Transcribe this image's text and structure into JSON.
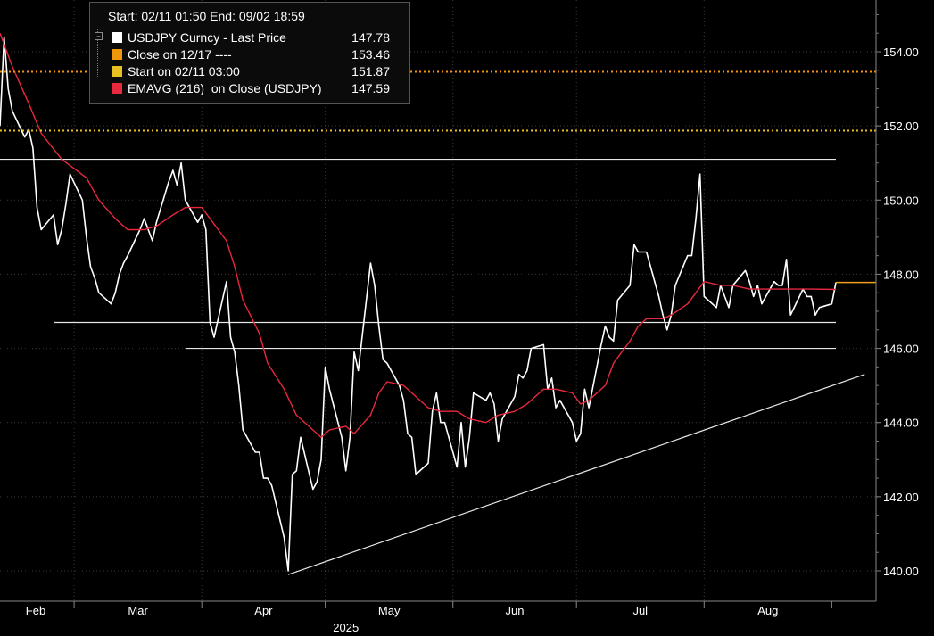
{
  "legend": {
    "header": "Start: 02/11 01:50 End: 09/02 18:59",
    "items": [
      {
        "label": "USDJPY Curncy - Last Price",
        "value": "147.78",
        "color": "#ffffff"
      },
      {
        "label": "Close on 12/17 ----",
        "value": "153.46",
        "color": "#f0960a"
      },
      {
        "label": "Start on 02/11 03:00",
        "value": "151.87",
        "color": "#e8c020"
      },
      {
        "label": "EMAVG (216)  on Close (USDJPY)",
        "value": "147.59",
        "color": "#e8283c"
      }
    ]
  },
  "chart_data": {
    "type": "line",
    "x_axis": {
      "months": [
        "Feb",
        "Mar",
        "Apr",
        "May",
        "Jun",
        "Jul",
        "Aug"
      ],
      "year": "2025",
      "range": [
        "2025-02-11",
        "2025-09-02"
      ]
    },
    "y_axis": {
      "ticks": [
        "154.00",
        "152.00",
        "150.00",
        "148.00",
        "146.00",
        "144.00",
        "142.00",
        "140.00"
      ],
      "range": [
        139.6,
        155.6
      ],
      "position": "right"
    },
    "series": [
      {
        "name": "USDJPY Curncy - Last Price",
        "color": "#ffffff",
        "points": [
          [
            "2025-02-11",
            152.0
          ],
          [
            "2025-02-12",
            154.4
          ],
          [
            "2025-02-13",
            153.0
          ],
          [
            "2025-02-14",
            152.4
          ],
          [
            "2025-02-17",
            151.7
          ],
          [
            "2025-02-18",
            151.9
          ],
          [
            "2025-02-19",
            151.4
          ],
          [
            "2025-02-20",
            149.8
          ],
          [
            "2025-02-21",
            149.2
          ],
          [
            "2025-02-24",
            149.6
          ],
          [
            "2025-02-25",
            148.8
          ],
          [
            "2025-02-26",
            149.2
          ],
          [
            "2025-02-27",
            149.9
          ],
          [
            "2025-02-28",
            150.7
          ],
          [
            "2025-03-03",
            150.0
          ],
          [
            "2025-03-04",
            149.0
          ],
          [
            "2025-03-05",
            148.2
          ],
          [
            "2025-03-06",
            147.9
          ],
          [
            "2025-03-07",
            147.5
          ],
          [
            "2025-03-10",
            147.2
          ],
          [
            "2025-03-11",
            147.5
          ],
          [
            "2025-03-12",
            148.0
          ],
          [
            "2025-03-13",
            148.3
          ],
          [
            "2025-03-14",
            148.5
          ],
          [
            "2025-03-17",
            149.2
          ],
          [
            "2025-03-18",
            149.5
          ],
          [
            "2025-03-19",
            149.2
          ],
          [
            "2025-03-20",
            148.9
          ],
          [
            "2025-03-21",
            149.4
          ],
          [
            "2025-03-24",
            150.5
          ],
          [
            "2025-03-25",
            150.8
          ],
          [
            "2025-03-26",
            150.4
          ],
          [
            "2025-03-27",
            151.0
          ],
          [
            "2025-03-28",
            150.0
          ],
          [
            "2025-03-31",
            149.4
          ],
          [
            "2025-04-01",
            149.6
          ],
          [
            "2025-04-02",
            149.2
          ],
          [
            "2025-04-03",
            146.7
          ],
          [
            "2025-04-04",
            146.3
          ],
          [
            "2025-04-07",
            147.8
          ],
          [
            "2025-04-08",
            146.3
          ],
          [
            "2025-04-09",
            145.9
          ],
          [
            "2025-04-10",
            145.0
          ],
          [
            "2025-04-11",
            143.8
          ],
          [
            "2025-04-14",
            143.2
          ],
          [
            "2025-04-15",
            143.2
          ],
          [
            "2025-04-16",
            142.5
          ],
          [
            "2025-04-17",
            142.5
          ],
          [
            "2025-04-18",
            142.3
          ],
          [
            "2025-04-21",
            140.9
          ],
          [
            "2025-04-22",
            140.0
          ],
          [
            "2025-04-23",
            142.6
          ],
          [
            "2025-04-24",
            142.7
          ],
          [
            "2025-04-25",
            143.6
          ],
          [
            "2025-04-28",
            142.2
          ],
          [
            "2025-04-29",
            142.4
          ],
          [
            "2025-04-30",
            143.0
          ],
          [
            "2025-05-01",
            145.5
          ],
          [
            "2025-05-02",
            144.9
          ],
          [
            "2025-05-05",
            143.6
          ],
          [
            "2025-05-06",
            142.7
          ],
          [
            "2025-05-07",
            143.6
          ],
          [
            "2025-05-08",
            145.9
          ],
          [
            "2025-05-09",
            145.4
          ],
          [
            "2025-05-12",
            148.3
          ],
          [
            "2025-05-13",
            147.7
          ],
          [
            "2025-05-14",
            146.6
          ],
          [
            "2025-05-15",
            145.7
          ],
          [
            "2025-05-16",
            145.6
          ],
          [
            "2025-05-19",
            145.0
          ],
          [
            "2025-05-20",
            144.6
          ],
          [
            "2025-05-21",
            143.7
          ],
          [
            "2025-05-22",
            143.6
          ],
          [
            "2025-05-23",
            142.6
          ],
          [
            "2025-05-26",
            142.9
          ],
          [
            "2025-05-27",
            144.3
          ],
          [
            "2025-05-28",
            144.8
          ],
          [
            "2025-05-29",
            144.0
          ],
          [
            "2025-05-30",
            144.0
          ],
          [
            "2025-06-02",
            142.8
          ],
          [
            "2025-06-03",
            144.0
          ],
          [
            "2025-06-04",
            142.8
          ],
          [
            "2025-06-05",
            143.6
          ],
          [
            "2025-06-06",
            144.8
          ],
          [
            "2025-06-09",
            144.6
          ],
          [
            "2025-06-10",
            144.8
          ],
          [
            "2025-06-11",
            144.5
          ],
          [
            "2025-06-12",
            143.5
          ],
          [
            "2025-06-13",
            144.1
          ],
          [
            "2025-06-16",
            144.7
          ],
          [
            "2025-06-17",
            145.3
          ],
          [
            "2025-06-18",
            145.2
          ],
          [
            "2025-06-19",
            145.4
          ],
          [
            "2025-06-20",
            146.0
          ],
          [
            "2025-06-23",
            146.1
          ],
          [
            "2025-06-24",
            144.9
          ],
          [
            "2025-06-25",
            145.2
          ],
          [
            "2025-06-26",
            144.4
          ],
          [
            "2025-06-27",
            144.6
          ],
          [
            "2025-06-30",
            144.0
          ],
          [
            "2025-07-01",
            143.5
          ],
          [
            "2025-07-02",
            143.7
          ],
          [
            "2025-07-03",
            144.9
          ],
          [
            "2025-07-04",
            144.4
          ],
          [
            "2025-07-07",
            146.1
          ],
          [
            "2025-07-08",
            146.6
          ],
          [
            "2025-07-09",
            146.3
          ],
          [
            "2025-07-10",
            146.2
          ],
          [
            "2025-07-11",
            147.3
          ],
          [
            "2025-07-14",
            147.7
          ],
          [
            "2025-07-15",
            148.8
          ],
          [
            "2025-07-16",
            148.6
          ],
          [
            "2025-07-17",
            148.6
          ],
          [
            "2025-07-18",
            148.6
          ],
          [
            "2025-07-21",
            147.4
          ],
          [
            "2025-07-22",
            146.9
          ],
          [
            "2025-07-23",
            146.5
          ],
          [
            "2025-07-24",
            146.9
          ],
          [
            "2025-07-25",
            147.7
          ],
          [
            "2025-07-28",
            148.5
          ],
          [
            "2025-07-29",
            148.5
          ],
          [
            "2025-07-30",
            149.5
          ],
          [
            "2025-07-31",
            150.7
          ],
          [
            "2025-08-01",
            147.4
          ],
          [
            "2025-08-04",
            147.1
          ],
          [
            "2025-08-05",
            147.7
          ],
          [
            "2025-08-06",
            147.4
          ],
          [
            "2025-08-07",
            147.1
          ],
          [
            "2025-08-08",
            147.7
          ],
          [
            "2025-08-11",
            148.1
          ],
          [
            "2025-08-12",
            147.8
          ],
          [
            "2025-08-13",
            147.4
          ],
          [
            "2025-08-14",
            147.7
          ],
          [
            "2025-08-15",
            147.2
          ],
          [
            "2025-08-18",
            147.8
          ],
          [
            "2025-08-19",
            147.7
          ],
          [
            "2025-08-20",
            147.7
          ],
          [
            "2025-08-21",
            148.4
          ],
          [
            "2025-08-22",
            146.9
          ],
          [
            "2025-08-25",
            147.6
          ],
          [
            "2025-08-26",
            147.4
          ],
          [
            "2025-08-27",
            147.4
          ],
          [
            "2025-08-28",
            146.9
          ],
          [
            "2025-08-29",
            147.1
          ],
          [
            "2025-09-01",
            147.2
          ],
          [
            "2025-09-02",
            147.78
          ]
        ]
      },
      {
        "name": "EMAVG (216)  on Close (USDJPY)",
        "color": "#e8283c",
        "points": [
          [
            "2025-02-11",
            154.5
          ],
          [
            "2025-02-14",
            153.6
          ],
          [
            "2025-02-18",
            152.6
          ],
          [
            "2025-02-21",
            151.8
          ],
          [
            "2025-02-26",
            151.1
          ],
          [
            "2025-03-04",
            150.6
          ],
          [
            "2025-03-07",
            150.0
          ],
          [
            "2025-03-11",
            149.5
          ],
          [
            "2025-03-14",
            149.2
          ],
          [
            "2025-03-18",
            149.2
          ],
          [
            "2025-03-21",
            149.3
          ],
          [
            "2025-03-25",
            149.6
          ],
          [
            "2025-03-28",
            149.8
          ],
          [
            "2025-04-01",
            149.8
          ],
          [
            "2025-04-03",
            149.5
          ],
          [
            "2025-04-07",
            148.9
          ],
          [
            "2025-04-09",
            148.2
          ],
          [
            "2025-04-11",
            147.3
          ],
          [
            "2025-04-15",
            146.4
          ],
          [
            "2025-04-17",
            145.6
          ],
          [
            "2025-04-21",
            144.9
          ],
          [
            "2025-04-24",
            144.2
          ],
          [
            "2025-04-28",
            143.8
          ],
          [
            "2025-04-30",
            143.6
          ],
          [
            "2025-05-02",
            143.8
          ],
          [
            "2025-05-06",
            143.9
          ],
          [
            "2025-05-08",
            143.7
          ],
          [
            "2025-05-12",
            144.2
          ],
          [
            "2025-05-14",
            144.8
          ],
          [
            "2025-05-16",
            145.1
          ],
          [
            "2025-05-20",
            145.0
          ],
          [
            "2025-05-22",
            144.8
          ],
          [
            "2025-05-26",
            144.4
          ],
          [
            "2025-05-29",
            144.3
          ],
          [
            "2025-06-02",
            144.3
          ],
          [
            "2025-06-05",
            144.1
          ],
          [
            "2025-06-09",
            144.0
          ],
          [
            "2025-06-12",
            144.2
          ],
          [
            "2025-06-16",
            144.3
          ],
          [
            "2025-06-19",
            144.5
          ],
          [
            "2025-06-23",
            144.9
          ],
          [
            "2025-06-26",
            144.9
          ],
          [
            "2025-06-30",
            144.8
          ],
          [
            "2025-07-02",
            144.5
          ],
          [
            "2025-07-04",
            144.6
          ],
          [
            "2025-07-08",
            145.0
          ],
          [
            "2025-07-10",
            145.6
          ],
          [
            "2025-07-14",
            146.2
          ],
          [
            "2025-07-16",
            146.6
          ],
          [
            "2025-07-18",
            146.8
          ],
          [
            "2025-07-22",
            146.8
          ],
          [
            "2025-07-24",
            146.9
          ],
          [
            "2025-07-28",
            147.2
          ],
          [
            "2025-07-30",
            147.5
          ],
          [
            "2025-08-01",
            147.8
          ],
          [
            "2025-08-05",
            147.7
          ],
          [
            "2025-08-08",
            147.7
          ],
          [
            "2025-08-12",
            147.6
          ],
          [
            "2025-08-15",
            147.6
          ],
          [
            "2025-08-19",
            147.6
          ],
          [
            "2025-08-22",
            147.6
          ],
          [
            "2025-08-27",
            147.6
          ],
          [
            "2025-09-02",
            147.59
          ]
        ]
      },
      {
        "name": "Start on 02/11 03:00",
        "color": "#e8c020",
        "style": "dotted",
        "constant": 151.87
      },
      {
        "name": "Close on 12/17 ----",
        "color": "#f0960a",
        "style": "dotted",
        "constant": 153.46
      }
    ],
    "reference_lines": [
      {
        "color": "#ffffff",
        "from": [
          "2025-02-11",
          151.1
        ],
        "to": [
          "2025-09-02",
          151.1
        ]
      },
      {
        "color": "#ffffff",
        "from": [
          "2025-02-24",
          146.7
        ],
        "to": [
          "2025-09-02",
          146.7
        ]
      },
      {
        "color": "#ffffff",
        "from": [
          "2025-03-28",
          146.0
        ],
        "to": [
          "2025-09-02",
          146.0
        ]
      },
      {
        "color": "#ffffff",
        "from": [
          "2025-04-22",
          139.9
        ],
        "to": [
          "2025-09-09",
          145.3
        ]
      }
    ],
    "last_price_marker": {
      "value": 147.78,
      "color": "#f0a020"
    },
    "grid": true
  }
}
